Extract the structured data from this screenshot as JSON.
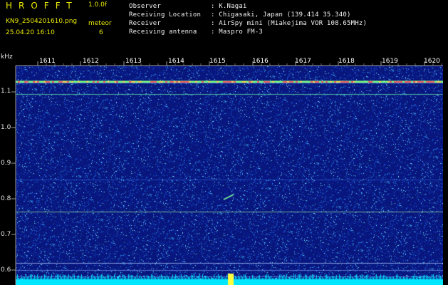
{
  "app": {
    "logo": "HROFFT",
    "version": "1.0.0f",
    "filename": "KN9_2504201610.png",
    "timestamp": "25.04.20 16:10",
    "mode_label": "meteor",
    "count": "6"
  },
  "info": {
    "rows": [
      {
        "label": "Observer",
        "value": ": K.Nagai"
      },
      {
        "label": "Receiving Location",
        "value": ": Chigasaki, Japan (139.414 35.340)"
      },
      {
        "label": "Receiver",
        "value": ": AirSpy mini (Miakejima VOR 108.65MHz)"
      },
      {
        "label": "Receiving antenna",
        "value": ": Maspro FM-3"
      }
    ]
  },
  "axes": {
    "y_unit": "kHz",
    "y_ticks": [
      "1.1",
      "1.0",
      "0.9",
      "0.8",
      "0.7",
      "0.6"
    ],
    "x_ticks": [
      "1611",
      "1612",
      "1613",
      "1614",
      "1615",
      "1616",
      "1617",
      "1618",
      "1619",
      "1620"
    ]
  },
  "colors": {
    "background": "#000000",
    "spectrogram_noise": "#0a1a7a",
    "header_text": "#f2f2f2",
    "accent_yellow": "#e8e800",
    "trace_cyan": "#00e6ff"
  }
}
